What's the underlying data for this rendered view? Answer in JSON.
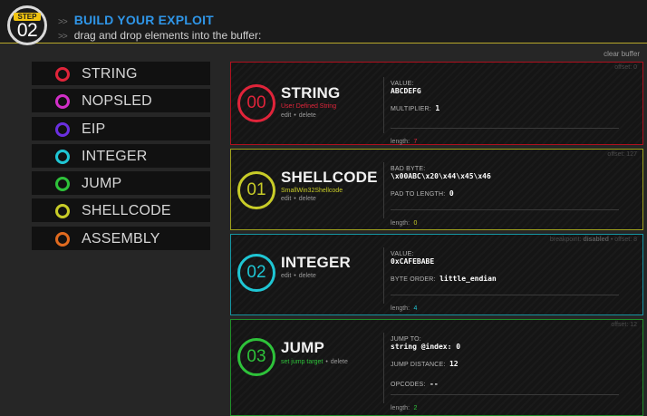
{
  "header": {
    "step_label": "STEP",
    "step_number": "02",
    "arrows": ">>",
    "title": "BUILD YOUR EXPLOIT",
    "subtitle": "drag and drop elements into the buffer:"
  },
  "clear_buffer": "clear buffer",
  "palette": [
    {
      "label": "STRING",
      "color": "#e0243a"
    },
    {
      "label": "NOPSLED",
      "color": "#d22fc8"
    },
    {
      "label": "EIP",
      "color": "#6a2fe0"
    },
    {
      "label": "INTEGER",
      "color": "#1fc6d4"
    },
    {
      "label": "JUMP",
      "color": "#2ec23a"
    },
    {
      "label": "SHELLCODE",
      "color": "#c8cc28"
    },
    {
      "label": "ASSEMBLY",
      "color": "#e06a1f"
    }
  ],
  "cards": [
    {
      "index": "00",
      "title": "STRING",
      "subtitle": "User Defined String",
      "color": "#e0243a",
      "border": "#b0101e",
      "meta": "offset: 0",
      "edit": "edit",
      "delete": "delete",
      "value_label": "VALUE:",
      "value": "ABCDEFG",
      "multiplier_label": "MULTIPLIER:",
      "multiplier": "1",
      "length_label": "length:",
      "length": "7"
    },
    {
      "index": "01",
      "title": "SHELLCODE",
      "subtitle": "SmallWin32Shellcode",
      "color": "#c8cc28",
      "border": "#9fa11c",
      "meta": "offset: 127",
      "edit": "edit",
      "delete": "delete",
      "bad_label": "BAD BYTE:",
      "bad_value": "\\x00ABC\\x20\\x44\\x45\\x46",
      "pad_label": "PAD TO LENGTH:",
      "pad_value": "0",
      "length_label": "length:",
      "length": "0"
    },
    {
      "index": "02",
      "title": "INTEGER",
      "color": "#1fc6d4",
      "border": "#1596a2",
      "meta_prefix": "breakpoint:",
      "meta_state": "disabled",
      "meta_sep": "•",
      "meta_offset": "offset: 8",
      "edit": "edit",
      "delete": "delete",
      "value_label": "VALUE:",
      "value": "0xCAFEBABE",
      "order_label": "BYTE ORDER:",
      "order_value": "little_endian",
      "length_label": "length:",
      "length": "4"
    },
    {
      "index": "03",
      "title": "JUMP",
      "color": "#2ec23a",
      "border": "#1f8f28",
      "meta": "offset: 12",
      "set_target": "set jump target",
      "delete": "delete",
      "jump_to_label": "JUMP TO:",
      "jump_to_value": "string @index: 0",
      "distance_label": "JUMP DISTANCE:",
      "distance_value": "12",
      "opcodes_label": "OPCODES:",
      "opcodes_value": "--",
      "length_label": "length:",
      "length": "2"
    }
  ]
}
